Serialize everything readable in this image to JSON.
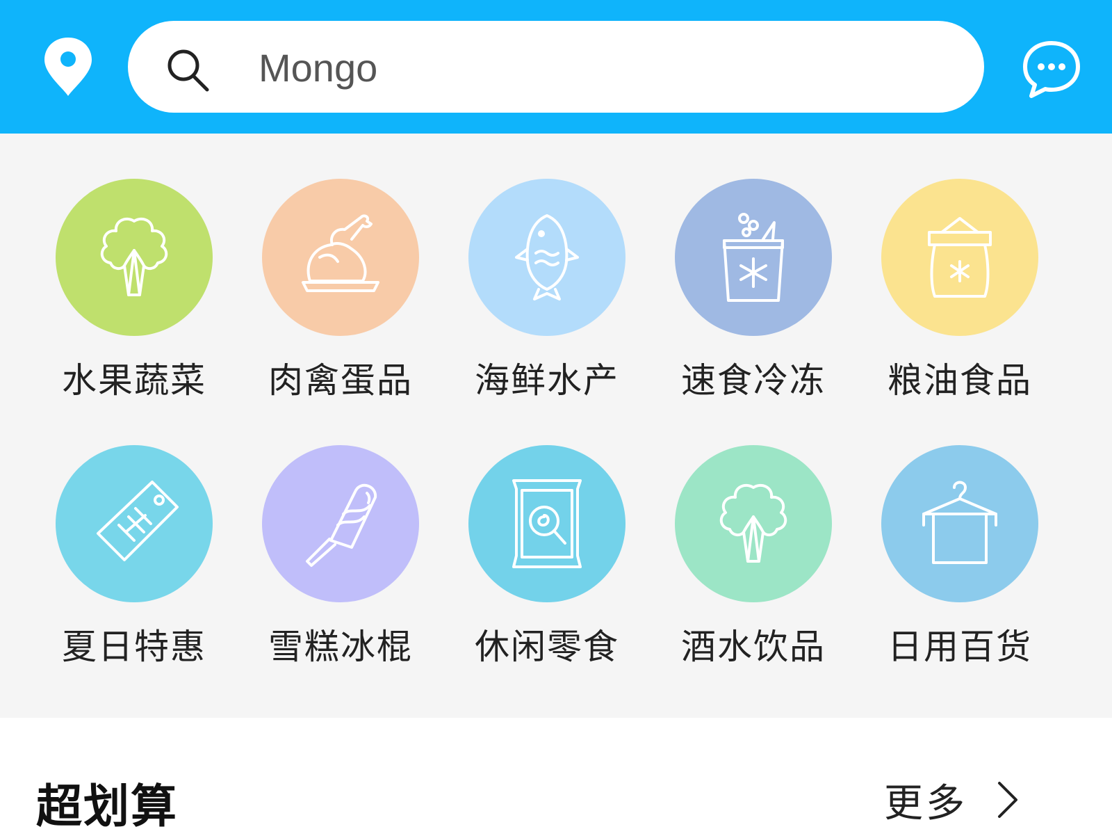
{
  "header": {
    "search_placeholder": "Mongo",
    "location_icon": "location-pin-icon",
    "search_icon": "search-icon",
    "message_icon": "chat-bubble-icon"
  },
  "categories": [
    {
      "label": "水果蔬菜",
      "icon": "vegetable-icon",
      "color": "#bfe06d"
    },
    {
      "label": "肉禽蛋品",
      "icon": "roast-chicken-icon",
      "color": "#f8cba8"
    },
    {
      "label": "海鲜水产",
      "icon": "fish-icon",
      "color": "#b3dcfb"
    },
    {
      "label": "速食冷冻",
      "icon": "frozen-food-icon",
      "color": "#9fb9e3"
    },
    {
      "label": "粮油食品",
      "icon": "rice-sack-icon",
      "color": "#fbe38f"
    },
    {
      "label": "夏日特惠",
      "icon": "price-tag-icon",
      "color": "#78d6ea"
    },
    {
      "label": "雪糕冰棍",
      "icon": "ice-pop-icon",
      "color": "#c0befa"
    },
    {
      "label": "休闲零食",
      "icon": "snack-bag-icon",
      "color": "#73d2ea"
    },
    {
      "label": "酒水饮品",
      "icon": "drink-icon",
      "color": "#9ce5c6"
    },
    {
      "label": "日用百货",
      "icon": "hanger-icon",
      "color": "#8ccbec"
    }
  ],
  "section": {
    "title": "超划算",
    "more_label": "更多",
    "more_icon": "chevron-right-icon"
  },
  "colors": {
    "header_bg": "#0fb4fb",
    "grid_bg": "#f5f5f5"
  }
}
